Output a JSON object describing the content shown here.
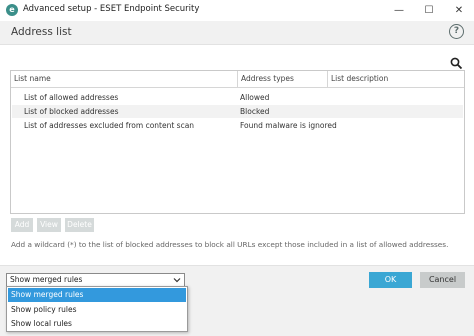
{
  "window": {
    "title": "Advanced setup - ESET Endpoint Security",
    "minimize_glyph": "—",
    "maximize_glyph": "☐",
    "close_glyph": "✕",
    "icon": "eset-logo-icon",
    "icon_letter": "e"
  },
  "header": {
    "title": "Address list",
    "help_glyph": "?"
  },
  "table": {
    "columns": [
      "List name",
      "Address types",
      "List description"
    ],
    "rows": [
      {
        "name": "List of allowed addresses",
        "type": "Allowed",
        "description": ""
      },
      {
        "name": "List of blocked addresses",
        "type": "Blocked",
        "description": ""
      },
      {
        "name": "List of addresses excluded from content scan",
        "type": "Found malware is ignored",
        "description": ""
      }
    ]
  },
  "actions": {
    "add": "Add",
    "view": "View",
    "delete": "Delete"
  },
  "note": "Add a wildcard (*) to the list of blocked addresses to block all URLs except those included in a list of allowed addresses.",
  "footer": {
    "rules_select": {
      "value": "Show merged rules",
      "options": [
        "Show merged rules",
        "Show policy rules",
        "Show local rules"
      ]
    },
    "ok": "OK",
    "cancel": "Cancel"
  },
  "colors": {
    "accent": "#3aa7d4",
    "selected_option": "#3399dd",
    "disabled_button": "#d5dada",
    "brand": "#3b8f8a"
  }
}
